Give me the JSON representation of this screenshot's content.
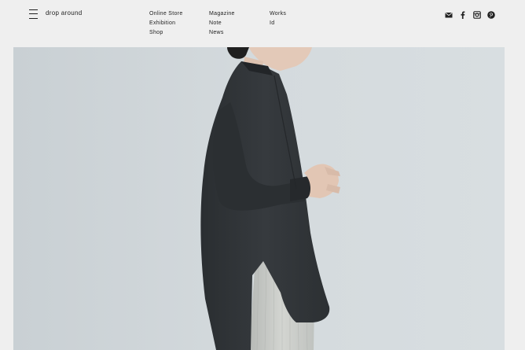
{
  "header": {
    "logo": "drop around",
    "nav": {
      "col1": [
        "Online Store",
        "Exhibition",
        "Shop"
      ],
      "col2": [
        "Magazine",
        "Note",
        "News"
      ],
      "col3": [
        "Works",
        "Id"
      ]
    },
    "social": [
      "mail-icon",
      "facebook-icon",
      "instagram-icon",
      "pinterest-icon"
    ]
  },
  "hero": {
    "subject": "photo-person-in-dark-shirt"
  },
  "colors": {
    "background": "#efefef",
    "text": "#222222",
    "hero_bg": "#d3d9dc",
    "shirt": "#2f3337"
  }
}
